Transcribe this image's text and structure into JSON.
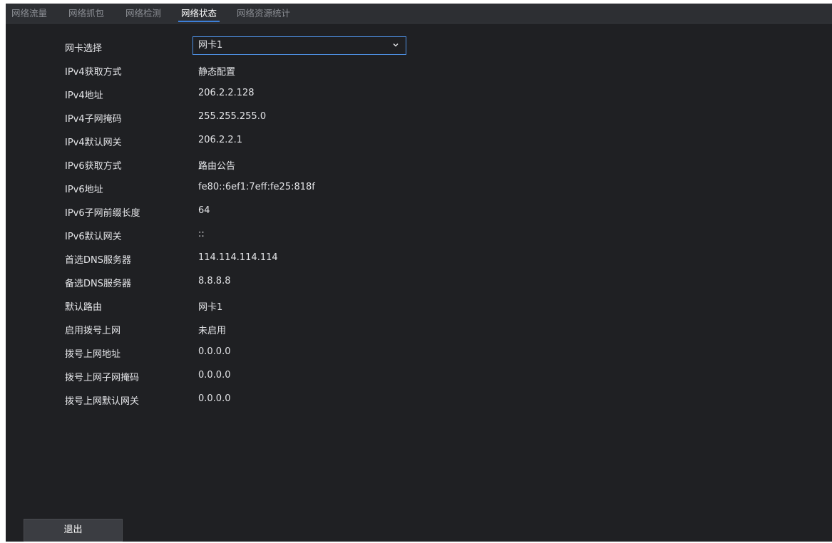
{
  "tabs": [
    {
      "label": "网络流量",
      "active": false
    },
    {
      "label": "网络抓包",
      "active": false
    },
    {
      "label": "网络检测",
      "active": false
    },
    {
      "label": "网络状态",
      "active": true
    },
    {
      "label": "网络资源统计",
      "active": false
    }
  ],
  "nic_select": {
    "label": "网卡选择",
    "value": "网卡1"
  },
  "fields": [
    {
      "label": "IPv4获取方式",
      "value": "静态配置"
    },
    {
      "label": "IPv4地址",
      "value": "206.2.2.128"
    },
    {
      "label": "IPv4子网掩码",
      "value": "255.255.255.0"
    },
    {
      "label": "IPv4默认网关",
      "value": "206.2.2.1"
    },
    {
      "label": "IPv6获取方式",
      "value": "路由公告"
    },
    {
      "label": "IPv6地址",
      "value": "fe80::6ef1:7eff:fe25:818f"
    },
    {
      "label": "IPv6子网前缀长度",
      "value": "64"
    },
    {
      "label": "IPv6默认网关",
      "value": "::"
    },
    {
      "label": "首选DNS服务器",
      "value": "114.114.114.114"
    },
    {
      "label": "备选DNS服务器",
      "value": "8.8.8.8"
    },
    {
      "label": "默认路由",
      "value": "网卡1"
    },
    {
      "label": "启用拨号上网",
      "value": "未启用"
    },
    {
      "label": "拨号上网地址",
      "value": "0.0.0.0"
    },
    {
      "label": "拨号上网子网掩码",
      "value": "0.0.0.0"
    },
    {
      "label": "拨号上网默认网关",
      "value": "0.0.0.0"
    }
  ],
  "footer": {
    "exit_label": "退出"
  },
  "icons": {
    "select_arrow": "chevron-down-icon"
  },
  "colors": {
    "background": "#1f2023",
    "tabbar": "#2d2f33",
    "accent": "#3d7fd8",
    "text": "#e4e5e8",
    "tab_inactive": "#8a8d93"
  }
}
